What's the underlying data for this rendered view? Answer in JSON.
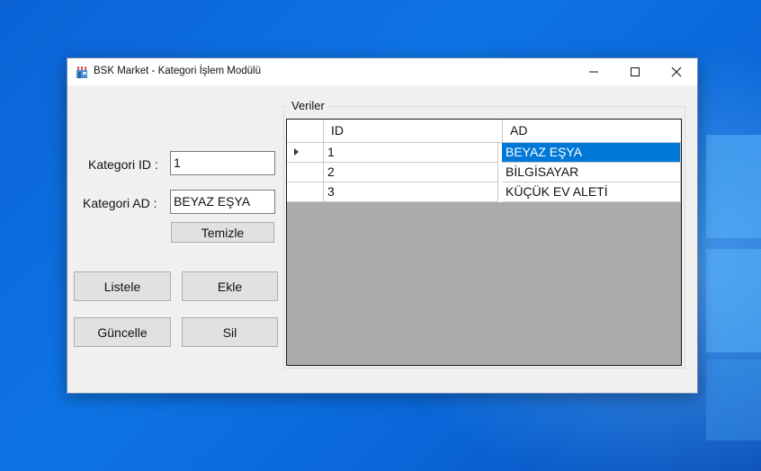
{
  "window": {
    "title": "BSK Market - Kategori İşlem Modülü",
    "icon": "store-icon"
  },
  "form": {
    "id_label": "Kategori ID :",
    "id_value": "1",
    "ad_label": "Kategori AD :",
    "ad_value": "BEYAZ EŞYA",
    "clear_button": "Temizle",
    "list_button": "Listele",
    "add_button": "Ekle",
    "update_button": "Güncelle",
    "delete_button": "Sil"
  },
  "grid": {
    "group_title": "Veriler",
    "columns": [
      "ID",
      "AD"
    ],
    "rows": [
      {
        "id": "1",
        "ad": "BEYAZ EŞYA",
        "selected": true
      },
      {
        "id": "2",
        "ad": "BİLGİSAYAR",
        "selected": false
      },
      {
        "id": "3",
        "ad": "KÜÇÜK EV ALETİ",
        "selected": false
      }
    ]
  },
  "colors": {
    "selection": "#0078d7",
    "grid_background": "#ababab",
    "desktop": "#0a66d8"
  }
}
